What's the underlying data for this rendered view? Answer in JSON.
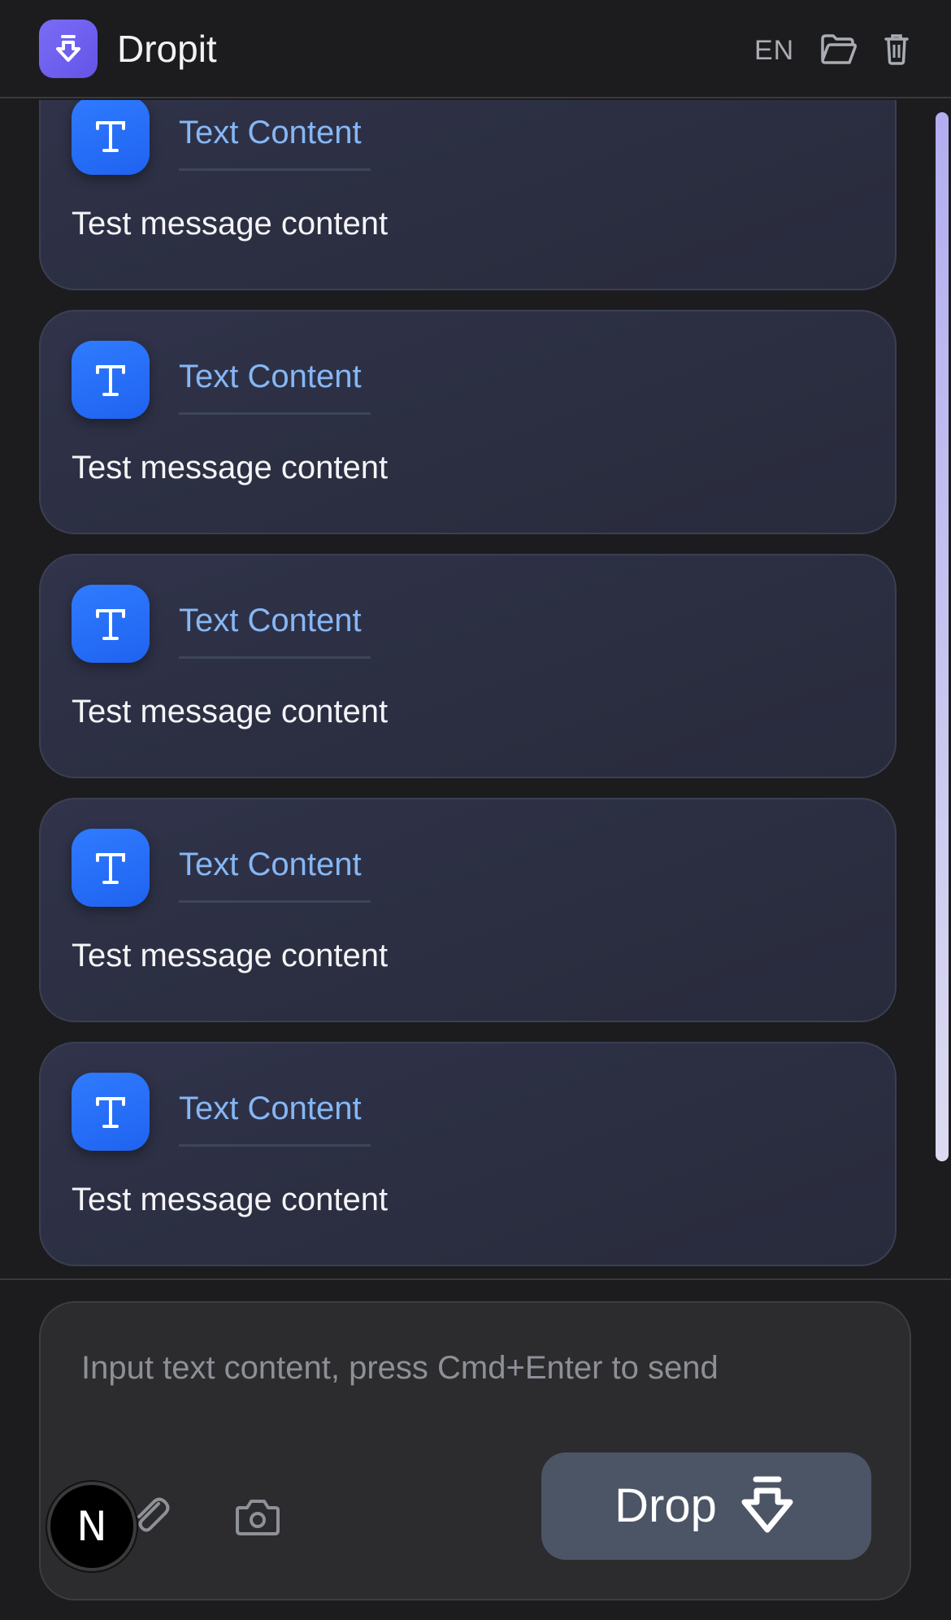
{
  "header": {
    "app_name": "Dropit",
    "language": "EN",
    "icons": [
      "drop-logo-icon",
      "folder-open-icon",
      "trash-icon"
    ]
  },
  "messages": [
    {
      "type_label": "Text Content",
      "content": "Test message content",
      "icon": "text-t-icon"
    },
    {
      "type_label": "Text Content",
      "content": "Test message content",
      "icon": "text-t-icon"
    },
    {
      "type_label": "Text Content",
      "content": "Test message content",
      "icon": "text-t-icon"
    },
    {
      "type_label": "Text Content",
      "content": "Test message content",
      "icon": "text-t-icon"
    },
    {
      "type_label": "Text Content",
      "content": "Test message content",
      "icon": "text-t-icon"
    }
  ],
  "composer": {
    "placeholder": "Input text content, press Cmd+Enter to send",
    "value": "",
    "drop_label": "Drop",
    "icons": [
      "paperclip-icon",
      "camera-icon",
      "drop-arrow-icon"
    ]
  },
  "badge": {
    "letter": "N"
  },
  "colors": {
    "accent_logo": "#6f5ff0",
    "avatar_blue": "#2870f8",
    "type_label": "#86b7f5",
    "card_bg": "#2d3044",
    "drop_button": "#4b5566",
    "scrollbar": "#c6c3ef"
  }
}
